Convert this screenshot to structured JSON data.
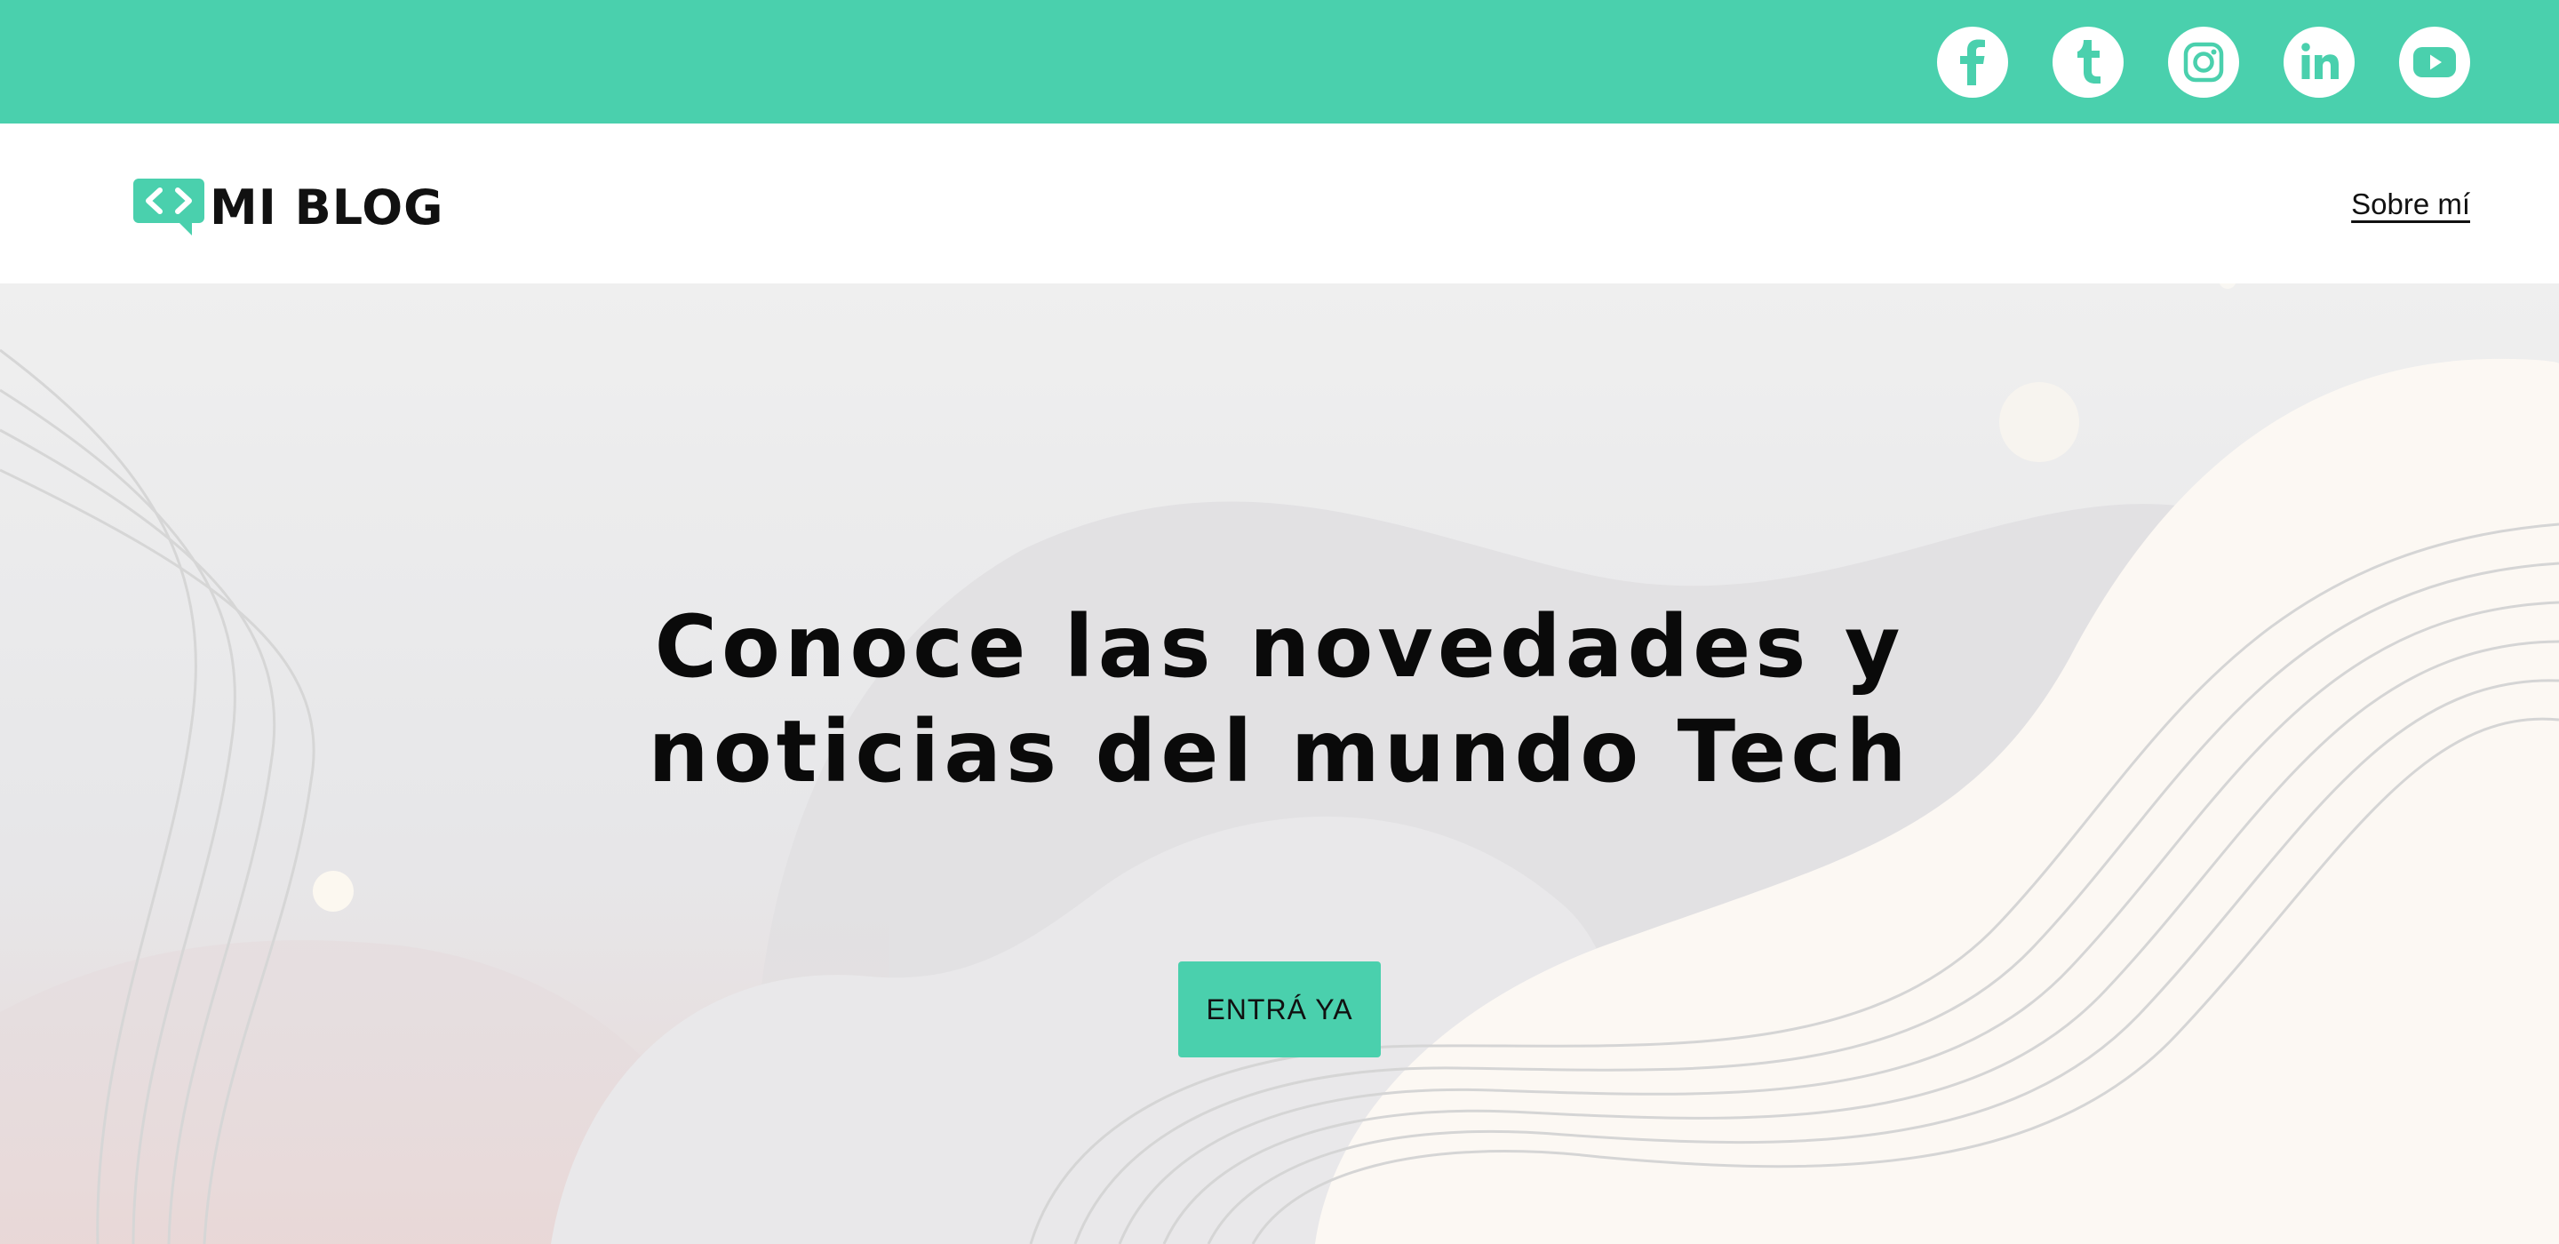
{
  "brand": {
    "name": "MI BLOG",
    "accent_color": "#4ad0ad"
  },
  "social_links": [
    {
      "icon": "facebook-icon"
    },
    {
      "icon": "tumblr-icon"
    },
    {
      "icon": "instagram-icon"
    },
    {
      "icon": "linkedin-icon"
    },
    {
      "icon": "youtube-icon"
    }
  ],
  "nav": {
    "items": [
      "Sobre mí"
    ]
  },
  "hero": {
    "title_line_1": "Conoce las novedades y",
    "title_line_2": "noticias del mundo Tech",
    "cta_label": "ENTRÁ YA"
  }
}
